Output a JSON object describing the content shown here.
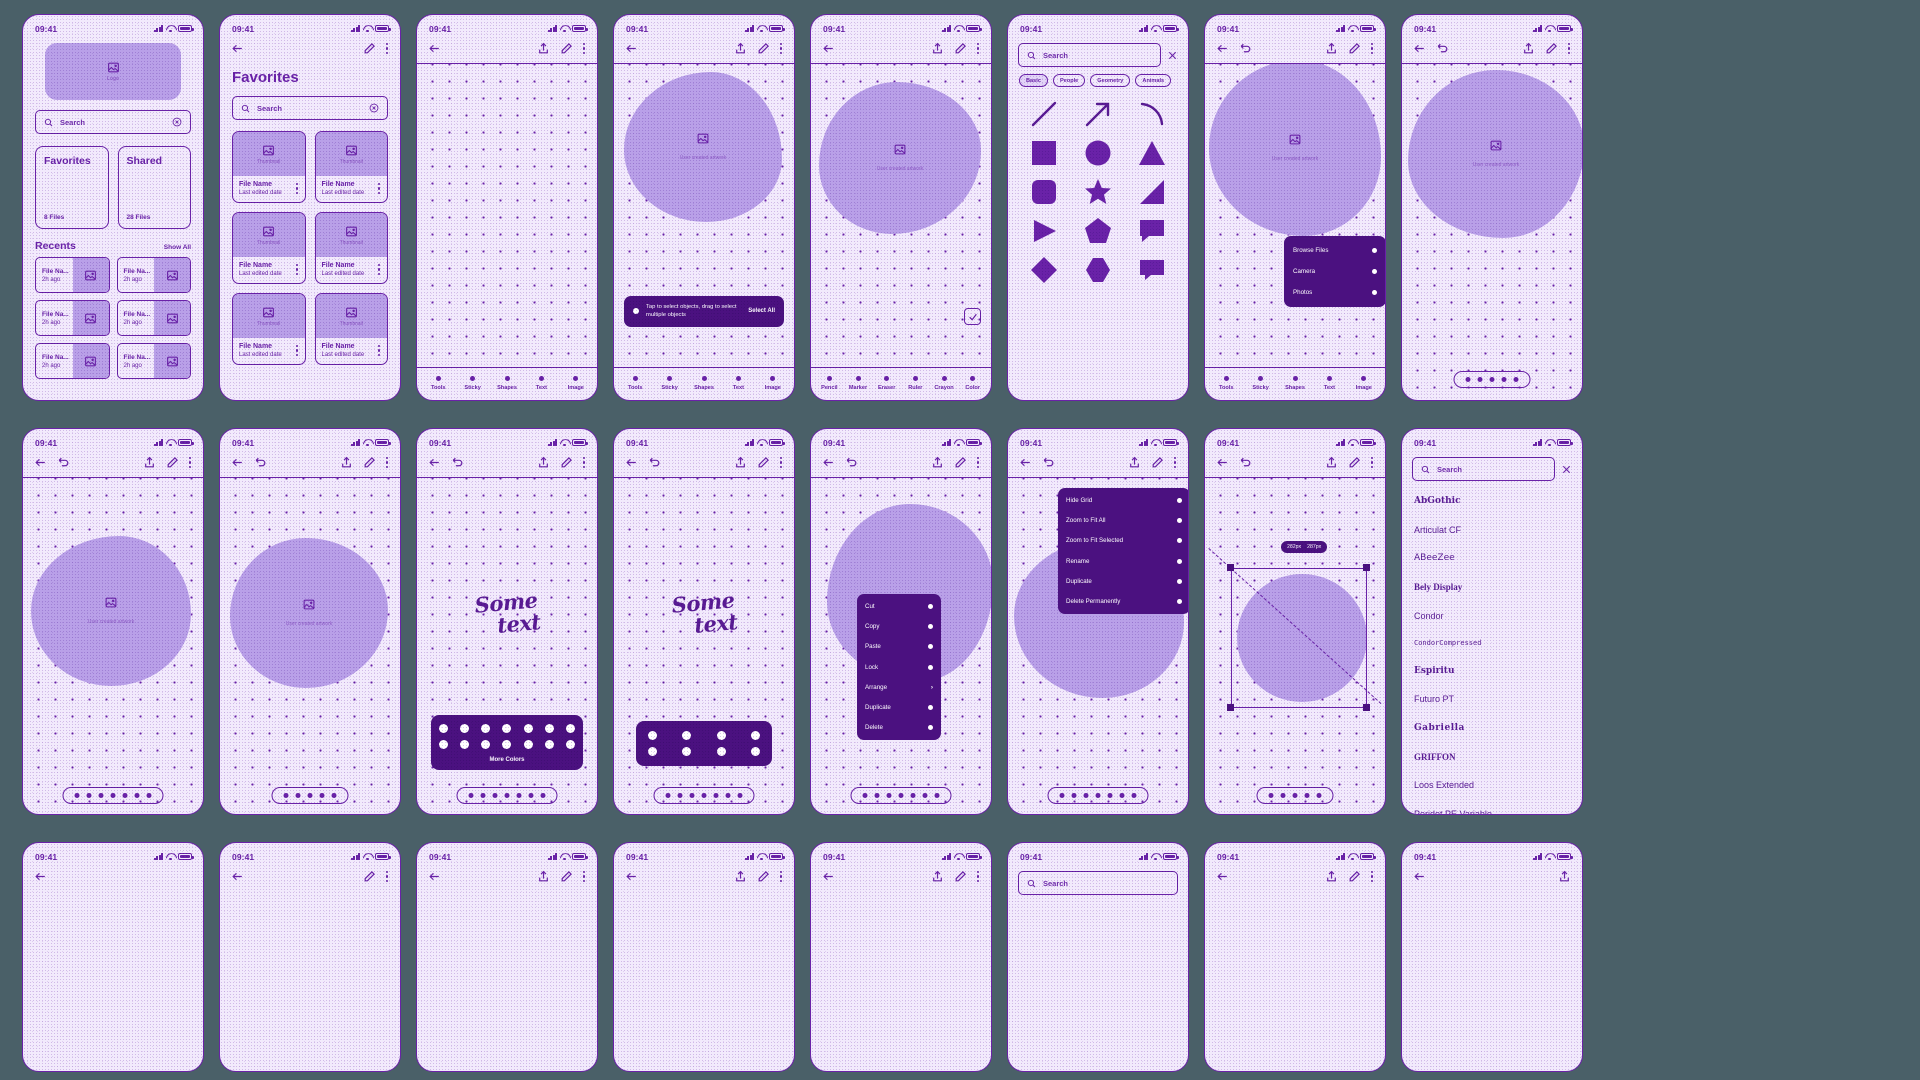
{
  "meta": {
    "background_color": "#4a6068",
    "ink_color": "#6a22a8",
    "screen_color": "#f0e8fb",
    "fill_color": "#b9a0e8",
    "menu_color": "#4b1180"
  },
  "status": {
    "time": "09:41",
    "icons": [
      "signal-icon",
      "wifi-icon",
      "battery-icon"
    ]
  },
  "home": {
    "logo_caption": "Logo",
    "search_placeholder": "Search",
    "cards": [
      {
        "title": "Favorites",
        "count": "8 Files"
      },
      {
        "title": "Shared",
        "count": "28 Files"
      }
    ],
    "recents_title": "Recents",
    "show_all": "Show All",
    "recents": [
      {
        "name": "File Na...",
        "time": "2h ago"
      },
      {
        "name": "File Na...",
        "time": "2h ago"
      },
      {
        "name": "File Na...",
        "time": "2h ago"
      },
      {
        "name": "File Na...",
        "time": "2h ago"
      },
      {
        "name": "File Na...",
        "time": "2h ago"
      },
      {
        "name": "File Na...",
        "time": "2h ago"
      }
    ]
  },
  "favorites": {
    "title": "Favorites",
    "search_placeholder": "Search",
    "thumb_caption": "Thumbnail",
    "tiles": [
      {
        "name": "File Name",
        "date": "Last edited date"
      },
      {
        "name": "File Name",
        "date": "Last edited date"
      },
      {
        "name": "File Name",
        "date": "Last edited date"
      },
      {
        "name": "File Name",
        "date": "Last edited date"
      },
      {
        "name": "File Name",
        "date": "Last edited date"
      },
      {
        "name": "File Name",
        "date": "Last edited date"
      }
    ]
  },
  "canvas": {
    "artwork_caption": "User created artwork",
    "toast": {
      "message": "Tap to select objects, drag to select multiple objects",
      "action": "Select All"
    }
  },
  "toolbar": {
    "main": [
      {
        "label": "Tools",
        "icon": "tools-icon"
      },
      {
        "label": "Sticky",
        "icon": "sticky-note-icon"
      },
      {
        "label": "Shapes",
        "icon": "shapes-icon"
      },
      {
        "label": "Text",
        "icon": "text-icon"
      },
      {
        "label": "Image",
        "icon": "image-icon"
      }
    ],
    "pens": [
      {
        "label": "Pencil",
        "icon": "pencil-icon"
      },
      {
        "label": "Marker",
        "icon": "marker-icon"
      },
      {
        "label": "Eraser",
        "icon": "eraser-icon"
      },
      {
        "label": "Ruler",
        "icon": "ruler-icon"
      },
      {
        "label": "Crayon",
        "icon": "crayon-icon"
      },
      {
        "label": "Color",
        "icon": "color-icon"
      }
    ]
  },
  "shapes_panel": {
    "search_placeholder": "Search",
    "close_icon": "close-icon",
    "categories": [
      {
        "label": "Basic",
        "selected": true
      },
      {
        "label": "People",
        "selected": false
      },
      {
        "label": "Geometry",
        "selected": false
      },
      {
        "label": "Animals",
        "selected": false
      }
    ],
    "shapes": [
      "line-shape",
      "arrow-shape",
      "arc-shape",
      "square-shape",
      "circle-shape",
      "triangle-shape",
      "rounded-square-shape",
      "star-shape",
      "right-triangle-shape",
      "play-triangle-shape",
      "pentagon-shape",
      "speech-bubble-shape",
      "diamond-shape",
      "hexagon-shape",
      "callout-shape"
    ]
  },
  "image_menu": {
    "items": [
      {
        "label": "Browse Files"
      },
      {
        "label": "Camera"
      },
      {
        "label": "Photos"
      }
    ]
  },
  "context_menu": {
    "items": [
      {
        "label": "Cut",
        "trailing": "dot"
      },
      {
        "label": "Copy",
        "trailing": "dot"
      },
      {
        "label": "Paste",
        "trailing": "dot"
      },
      {
        "label": "Lock",
        "trailing": "dot"
      },
      {
        "label": "Arrange",
        "trailing": "chevron"
      },
      {
        "label": "Duplicate",
        "trailing": "dot"
      },
      {
        "label": "Delete",
        "trailing": "dot"
      }
    ]
  },
  "overflow_menu": {
    "items": [
      {
        "label": "Hide Grid"
      },
      {
        "label": "Zoom to Fit All"
      },
      {
        "label": "Zoom to Fit Selected"
      },
      {
        "label": "Rename"
      },
      {
        "label": "Duplicate"
      },
      {
        "label": "Delete Permanently"
      }
    ]
  },
  "color_palette": {
    "more_label": "More Colors",
    "rows": 2,
    "per_row": 7
  },
  "text_sample": {
    "line1": "Some",
    "line2": "text"
  },
  "transform": {
    "width_label": "282px",
    "height_label": "287px"
  },
  "fonts_panel": {
    "search_placeholder": "Search",
    "close_icon": "close-icon",
    "fonts": [
      "AbGothic",
      "Articulat CF",
      "ABeeZee",
      "Bely Display",
      "Condor",
      "CondorCompressed",
      "Espiritu",
      "Futuro PT",
      "Gabriella",
      "GRIFFON",
      "Loos Extended",
      "Peridot PE Variable"
    ]
  },
  "page_dots": {
    "count": 5,
    "count_long": 7
  }
}
